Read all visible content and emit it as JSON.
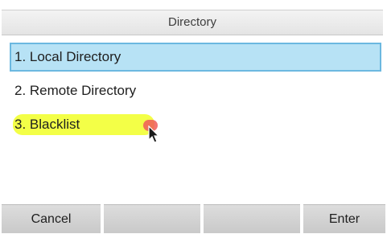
{
  "header": {
    "title": "Directory"
  },
  "menu": {
    "items": [
      {
        "label": "1. Local Directory",
        "selected": true
      },
      {
        "label": "2. Remote Directory",
        "selected": false
      },
      {
        "label": "3. Blacklist",
        "selected": false
      }
    ]
  },
  "softkeys": [
    {
      "label": "Cancel"
    },
    {
      "label": ""
    },
    {
      "label": ""
    },
    {
      "label": "Enter"
    }
  ],
  "colors": {
    "selection_fill": "#b7e2f5",
    "selection_border": "#6cb8e0",
    "annotation_highlight": "#f2ff33",
    "annotation_marker": "#ee5a5a"
  },
  "icons": {
    "pointer": "mouse-pointer-icon"
  }
}
